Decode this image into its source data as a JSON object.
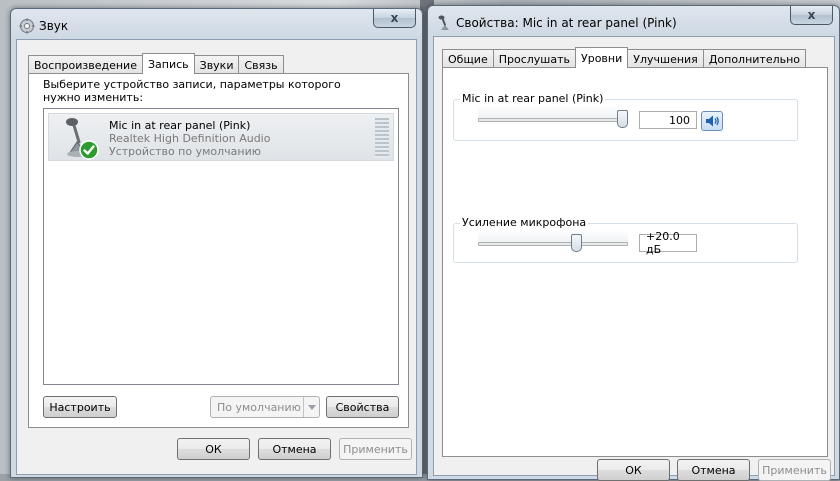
{
  "sound_window": {
    "title": "Звук",
    "close_glyph": "x",
    "tabs": [
      {
        "label": "Воспроизведение"
      },
      {
        "label": "Запись"
      },
      {
        "label": "Звуки"
      },
      {
        "label": "Связь"
      }
    ],
    "instruction": "Выберите устройство записи, параметры которого нужно изменить:",
    "device": {
      "name": "Mic in at rear panel (Pink)",
      "driver": "Realtek High Definition Audio",
      "status": "Устройство по умолчанию",
      "icon": "microphone-icon",
      "default_badge": "green-check-icon"
    },
    "configure_label": "Настроить",
    "default_label": "По умолчанию",
    "properties_label": "Свойства",
    "ok_label": "ОК",
    "cancel_label": "Отмена",
    "apply_label": "Применить"
  },
  "props_window": {
    "title": "Свойства: Mic in at rear panel (Pink)",
    "close_glyph": "x",
    "tabs": [
      {
        "label": "Общие"
      },
      {
        "label": "Прослушать"
      },
      {
        "label": "Уровни"
      },
      {
        "label": "Улучшения"
      },
      {
        "label": "Дополнительно"
      }
    ],
    "mic_group_label": "Mic in at rear panel (Pink)",
    "mic_level_value": "100",
    "mic_level_fraction": 1.0,
    "boost_group_label": "Усиление микрофона",
    "boost_value": "+20.0 дБ",
    "boost_fraction": 0.67,
    "ok_label": "ОК",
    "cancel_label": "Отмена",
    "apply_label": "Применить"
  },
  "colors": {
    "check_green": "#2e9b2e",
    "speaker_blue": "#1e5fb4"
  }
}
